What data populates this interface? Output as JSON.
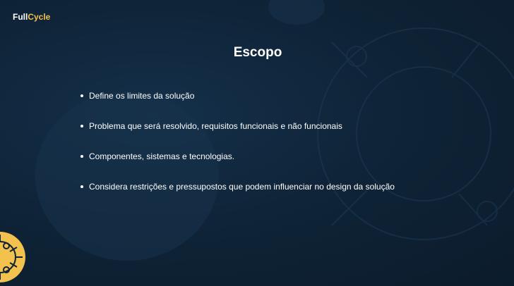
{
  "brand": {
    "logo_part1": "Full",
    "logo_part2": "Cycle",
    "accent_color": "#f2c14e",
    "background_color": "#0f2236"
  },
  "slide": {
    "title": "Escopo",
    "bullets": [
      "Define os limites da solução",
      "Problema que será resolvido, requisitos funcionais e não funcionais",
      "Componentes, sistemas e tecnologias.",
      "Considera restrições e pressupostos que podem influenciar no design da solução"
    ]
  }
}
